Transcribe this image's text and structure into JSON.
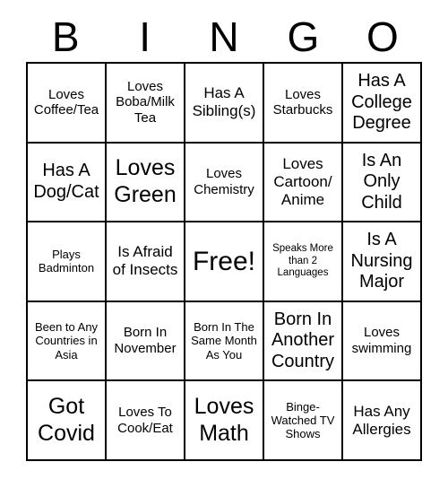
{
  "card": {
    "title": "BINGO",
    "header_letters": [
      "B",
      "I",
      "N",
      "G",
      "O"
    ],
    "grid_size": "5x5",
    "free_space": "Free!",
    "colors": {
      "background": "#ffffff",
      "border": "#000000",
      "text": "#000000"
    },
    "cells": [
      {
        "row": 1,
        "col": 1,
        "text": "Loves Coffee/Tea",
        "size": "fs-m"
      },
      {
        "row": 1,
        "col": 2,
        "text": "Loves Boba/Milk Tea",
        "size": "fs-m"
      },
      {
        "row": 1,
        "col": 3,
        "text": "Has A Sibling(s)",
        "size": "fs-l"
      },
      {
        "row": 1,
        "col": 4,
        "text": "Loves Starbucks",
        "size": "fs-m"
      },
      {
        "row": 1,
        "col": 5,
        "text": "Has A College Degree",
        "size": "fs-xl"
      },
      {
        "row": 2,
        "col": 1,
        "text": "Has A Dog/Cat",
        "size": "fs-xl"
      },
      {
        "row": 2,
        "col": 2,
        "text": "Loves Green",
        "size": "fs-xxl"
      },
      {
        "row": 2,
        "col": 3,
        "text": "Loves Chemistry",
        "size": "fs-m"
      },
      {
        "row": 2,
        "col": 4,
        "text": "Loves Cartoon/ Anime",
        "size": "fs-l"
      },
      {
        "row": 2,
        "col": 5,
        "text": "Is An Only Child",
        "size": "fs-xl"
      },
      {
        "row": 3,
        "col": 1,
        "text": "Plays Badminton",
        "size": "fs-s"
      },
      {
        "row": 3,
        "col": 2,
        "text": "Is Afraid of Insects",
        "size": "fs-l"
      },
      {
        "row": 3,
        "col": 3,
        "text": "Free!",
        "size": "fs-huge"
      },
      {
        "row": 3,
        "col": 4,
        "text": "Speaks More than 2 Languages",
        "size": "fs-xs"
      },
      {
        "row": 3,
        "col": 5,
        "text": "Is A Nursing Major",
        "size": "fs-xl"
      },
      {
        "row": 4,
        "col": 1,
        "text": "Been to Any Countries in Asia",
        "size": "fs-s"
      },
      {
        "row": 4,
        "col": 2,
        "text": "Born In November",
        "size": "fs-m"
      },
      {
        "row": 4,
        "col": 3,
        "text": "Born In The Same Month As You",
        "size": "fs-s"
      },
      {
        "row": 4,
        "col": 4,
        "text": "Born In Another Country",
        "size": "fs-xl"
      },
      {
        "row": 4,
        "col": 5,
        "text": "Loves swimming",
        "size": "fs-m"
      },
      {
        "row": 5,
        "col": 1,
        "text": "Got Covid",
        "size": "fs-xxl"
      },
      {
        "row": 5,
        "col": 2,
        "text": "Loves To Cook/Eat",
        "size": "fs-m"
      },
      {
        "row": 5,
        "col": 3,
        "text": "Loves Math",
        "size": "fs-xxl"
      },
      {
        "row": 5,
        "col": 4,
        "text": "Binge-Watched TV Shows",
        "size": "fs-s"
      },
      {
        "row": 5,
        "col": 5,
        "text": "Has Any Allergies",
        "size": "fs-l"
      }
    ]
  }
}
